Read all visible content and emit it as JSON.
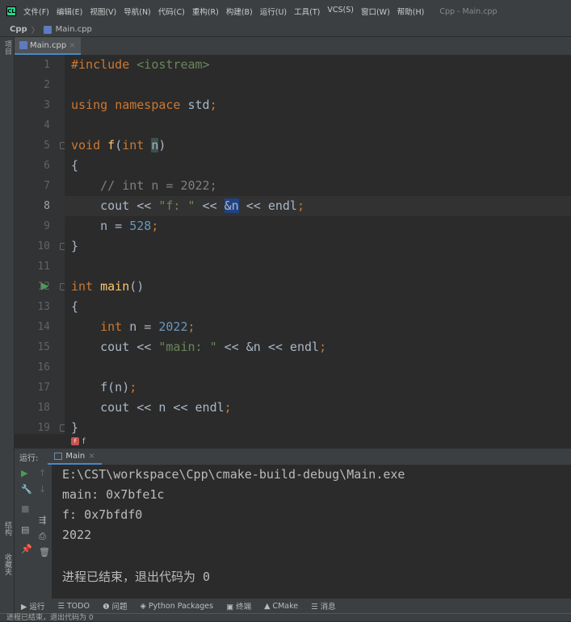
{
  "menubar": {
    "logo": "CL",
    "items": [
      "文件(F)",
      "编辑(E)",
      "视图(V)",
      "导航(N)",
      "代码(C)",
      "重构(R)",
      "构建(B)",
      "运行(U)",
      "工具(T)",
      "VCS(S)",
      "窗口(W)",
      "帮助(H)"
    ],
    "title": "Cpp - Main.cpp"
  },
  "navbar": {
    "project": "Cpp",
    "sep": "〉",
    "file": "Main.cpp"
  },
  "tab": {
    "label": "Main.cpp",
    "close": "×"
  },
  "leftstrip": {
    "project": "项目",
    "structure": "结构",
    "favorites": "收藏夹"
  },
  "editor": {
    "current_line": 8,
    "lines": [
      [
        [
          "#include ",
          "pp"
        ],
        [
          "<iostream>",
          "str"
        ]
      ],
      [],
      [
        [
          "using ",
          "kw"
        ],
        [
          "namespace ",
          "kw"
        ],
        [
          "std",
          ""
        ],
        [
          ";",
          "kw"
        ]
      ],
      [],
      [
        [
          "void ",
          "kw"
        ],
        [
          "f",
          "fn"
        ],
        [
          "(",
          ""
        ],
        [
          "int ",
          "kw"
        ],
        [
          "n",
          "par"
        ],
        [
          ")",
          ""
        ]
      ],
      [
        [
          "{",
          ""
        ]
      ],
      [
        [
          "    // int n = 2022;",
          "com"
        ]
      ],
      [
        [
          "    cout << ",
          ""
        ],
        [
          "\"f: \"",
          "str"
        ],
        [
          " << ",
          ""
        ],
        [
          "&n",
          "hl"
        ],
        [
          " << endl",
          ""
        ],
        [
          ";",
          "kw"
        ]
      ],
      [
        [
          "    ",
          ""
        ],
        [
          "n",
          ""
        ],
        [
          " = ",
          ""
        ],
        [
          "528",
          "num"
        ],
        [
          ";",
          "kw"
        ]
      ],
      [
        [
          "}",
          ""
        ]
      ],
      [],
      [
        [
          "int ",
          "kw"
        ],
        [
          "main",
          "fn"
        ],
        [
          "()",
          ""
        ]
      ],
      [
        [
          "{",
          ""
        ]
      ],
      [
        [
          "    ",
          ""
        ],
        [
          "int ",
          "kw"
        ],
        [
          "n = ",
          ""
        ],
        [
          "2022",
          "num"
        ],
        [
          ";",
          "kw"
        ]
      ],
      [
        [
          "    cout << ",
          ""
        ],
        [
          "\"main: \"",
          "str"
        ],
        [
          " << &n << endl",
          ""
        ],
        [
          ";",
          "kw"
        ]
      ],
      [],
      [
        [
          "    f(n)",
          ""
        ],
        [
          ";",
          "kw"
        ]
      ],
      [
        [
          "    cout << n << endl",
          ""
        ],
        [
          ";",
          "kw"
        ]
      ],
      [
        [
          "}",
          ""
        ]
      ]
    ]
  },
  "breadcrumb": {
    "badge": "f",
    "label": "f"
  },
  "run": {
    "label": "运行:",
    "tab": "Main",
    "close": "×",
    "output": [
      "E:\\CST\\workspace\\Cpp\\cmake-build-debug\\Main.exe",
      "main: 0x7bfe1c",
      "f: 0x7bfdf0",
      "2022",
      "",
      "进程已结束，退出代码为 0"
    ]
  },
  "bottombar": [
    "▶ 运行",
    "☰ TODO",
    "❶ 问题",
    "◈ Python Packages",
    "▣ 终端",
    "▲ CMake",
    "☰ 消息"
  ],
  "statusbar": "进程已结束，退出代码为 0"
}
